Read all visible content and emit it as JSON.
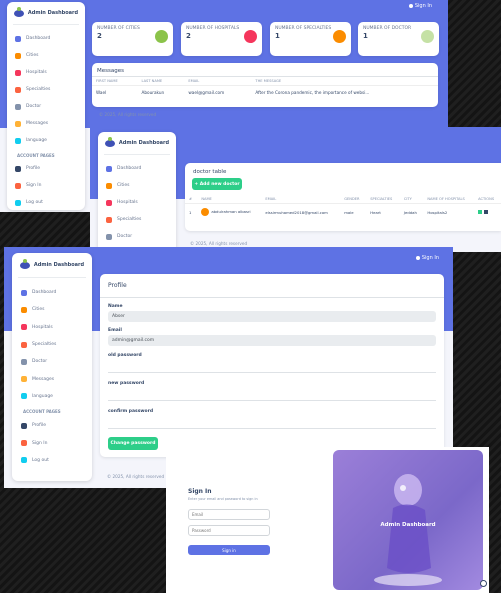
{
  "dashboard": {
    "brand": "Admin Dashboard",
    "signin_label": "Sign In",
    "nav": [
      {
        "label": "Dashboard",
        "icon": "monitor-icon",
        "color": "#5e72e4"
      },
      {
        "label": "Cities",
        "icon": "city-icon",
        "color": "#fb8c00"
      },
      {
        "label": "Hospitals",
        "icon": "hospital-icon",
        "color": "#f5365c"
      },
      {
        "label": "Specialties",
        "icon": "specialties-icon",
        "color": "#fb6340"
      },
      {
        "label": "Doctor",
        "icon": "doctor-icon",
        "color": "#8392ab"
      },
      {
        "label": "Messages",
        "icon": "message-icon",
        "color": "#ffb236"
      },
      {
        "label": "language",
        "icon": "globe-icon",
        "color": "#11cdef"
      }
    ],
    "account_label": "ACCOUNT PAGES",
    "account_nav": [
      {
        "label": "Profile",
        "icon": "profile-icon",
        "color": "#344767"
      },
      {
        "label": "Sign In",
        "icon": "signin-icon",
        "color": "#fb6340"
      },
      {
        "label": "Log out",
        "icon": "logout-icon",
        "color": "#11cdef"
      }
    ],
    "stats": [
      {
        "label": "NUMBER OF CITIES",
        "value": "2",
        "icon": "city-icon",
        "color": "#8bc34a"
      },
      {
        "label": "NUMBER OF HOSPITALS",
        "value": "2",
        "icon": "hospital-icon",
        "color": "#f5365c"
      },
      {
        "label": "NUMBER OF SPECIALTIES",
        "value": "1",
        "icon": "specialties-icon",
        "color": "#fb8c00"
      },
      {
        "label": "NUMBER OF DOCTOR",
        "value": "1",
        "icon": "doctor-icon",
        "color": "#c5e1a5"
      }
    ],
    "messages": {
      "title": "Messages",
      "headers": [
        "FIRST NAME",
        "LAST NAME",
        "EMAIL",
        "THE MESSAGE"
      ],
      "rows": [
        [
          "Wael",
          "Abourakun",
          "wael@gmail.com",
          "After the Corona pandemic, the importance of websi..."
        ]
      ]
    },
    "footer": "© 2025, All rights reserved"
  },
  "doctors": {
    "brand": "Admin Dashboard",
    "nav": [
      {
        "label": "Dashboard",
        "color": "#5e72e4"
      },
      {
        "label": "Cities",
        "color": "#fb8c00"
      },
      {
        "label": "Hospitals",
        "color": "#f5365c"
      },
      {
        "label": "Specialties",
        "color": "#fb6340"
      },
      {
        "label": "Doctor",
        "color": "#8392ab"
      }
    ],
    "title": "doctor table",
    "add_button": "+ Add new doctor",
    "headers": [
      "#",
      "NAME",
      "EMAIL",
      "GENDER",
      "SPECIALTIES",
      "CITY",
      "NAME OF HOSPITALS",
      "ACTIONS"
    ],
    "rows": [
      [
        "1",
        "abdulrahman albasri",
        "elssirmuhamed2018@gmail.com",
        "male",
        "Heart",
        "Jeddah",
        "Hospitals2"
      ]
    ],
    "footer": "© 2025, All rights reserved"
  },
  "profile": {
    "brand": "Admin Dashboard",
    "signin_label": "Sign In",
    "nav": [
      {
        "label": "Dashboard",
        "color": "#5e72e4"
      },
      {
        "label": "Cities",
        "color": "#fb8c00"
      },
      {
        "label": "Hospitals",
        "color": "#f5365c"
      },
      {
        "label": "Specialties",
        "color": "#fb6340"
      },
      {
        "label": "Doctor",
        "color": "#8392ab"
      },
      {
        "label": "Messages",
        "color": "#ffb236"
      },
      {
        "label": "language",
        "color": "#11cdef"
      }
    ],
    "account_label": "ACCOUNT PAGES",
    "account_nav": [
      {
        "label": "Profile",
        "color": "#344767"
      },
      {
        "label": "Sign In",
        "color": "#fb6340"
      },
      {
        "label": "Log out",
        "color": "#11cdef"
      }
    ],
    "title": "Profile",
    "name_label": "Name",
    "name_value": "Abser",
    "email_label": "Email",
    "email_value": "admin@gmail.com",
    "old_password_label": "old password",
    "new_password_label": "new password",
    "confirm_password_label": "confirm password",
    "change_button": "Change password",
    "footer": "© 2025, All rights reserved"
  },
  "signin": {
    "title": "Sign In",
    "subtitle": "Enter your email and password to sign in",
    "email_placeholder": "Email",
    "password_placeholder": "Password",
    "button": "Sign in",
    "panel_title": "Admin Dashboard"
  }
}
